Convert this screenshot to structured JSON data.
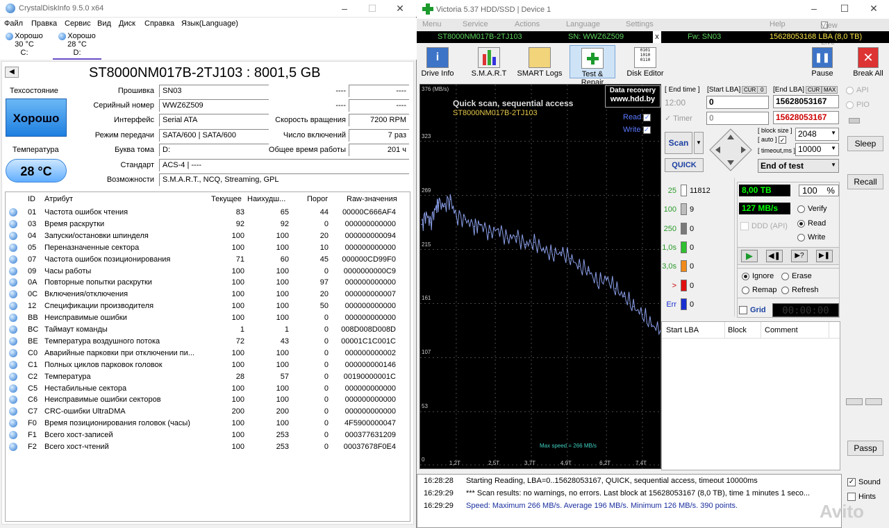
{
  "cdi": {
    "title": "CrystalDiskInfo 9.5.0 x64",
    "menu": [
      "Файл",
      "Правка",
      "Сервис",
      "Вид",
      "Диск",
      "Справка",
      "Язык(Language)"
    ],
    "disks": [
      {
        "status": "Хорошо",
        "temp": "30 °C",
        "letter": "C:"
      },
      {
        "status": "Хорошо",
        "temp": "28 °C",
        "letter": "D:"
      }
    ],
    "model": "ST8000NM017B-2TJ103 : 8001,5 GB",
    "health_label": "Техсостояние",
    "health_value": "Хорошо",
    "temp_label": "Температура",
    "temp_value": "28 °C",
    "fields": {
      "firmware": {
        "label": "Прошивка",
        "value": "SN03"
      },
      "serial": {
        "label": "Серийный номер",
        "value": "WWZ6Z509"
      },
      "interface": {
        "label": "Интерфейс",
        "value": "Serial ATA"
      },
      "transfer": {
        "label": "Режим передачи",
        "value": "SATA/600 | SATA/600"
      },
      "letter": {
        "label": "Буква тома",
        "value": "D:"
      },
      "standard": {
        "label": "Стандарт",
        "value": "ACS-4 | ----"
      },
      "features": {
        "label": "Возможности",
        "value": "S.M.A.R.T., NCQ, Streaming, GPL"
      },
      "dash1": "----",
      "dash2": "----",
      "dash3": "----",
      "dash4": "----",
      "rpm": {
        "label": "Скорость вращения",
        "value": "7200 RPM"
      },
      "power_count": {
        "label": "Число включений",
        "value": "7 раз"
      },
      "power_hours": {
        "label": "Общее время работы",
        "value": "201 ч"
      }
    },
    "smart_headers": [
      "ID",
      "Атрибут",
      "Текущее",
      "Наихудш...",
      "Порог",
      "Raw-значения"
    ],
    "smart_rows": [
      [
        "01",
        "Частота ошибок чтения",
        "83",
        "65",
        "44",
        "00000C666AF4"
      ],
      [
        "03",
        "Время раскрутки",
        "92",
        "92",
        "0",
        "000000000000"
      ],
      [
        "04",
        "Запуски/остановки шпинделя",
        "100",
        "100",
        "20",
        "000000000094"
      ],
      [
        "05",
        "Переназначенные сектора",
        "100",
        "100",
        "10",
        "000000000000"
      ],
      [
        "07",
        "Частота ошибок позиционирования",
        "71",
        "60",
        "45",
        "000000CD99F0"
      ],
      [
        "09",
        "Часы работы",
        "100",
        "100",
        "0",
        "0000000000C9"
      ],
      [
        "0A",
        "Повторные попытки раскрутки",
        "100",
        "100",
        "97",
        "000000000000"
      ],
      [
        "0C",
        "Включения/отключения",
        "100",
        "100",
        "20",
        "000000000007"
      ],
      [
        "12",
        "Спецификации производителя",
        "100",
        "100",
        "50",
        "000000000000"
      ],
      [
        "BB",
        "Неисправимые ошибки",
        "100",
        "100",
        "0",
        "000000000000"
      ],
      [
        "BC",
        "Таймаут команды",
        "1",
        "1",
        "0",
        "008D008D008D"
      ],
      [
        "BE",
        "Температура воздушного потока",
        "72",
        "43",
        "0",
        "00001C1C001C"
      ],
      [
        "C0",
        "Аварийные парковки при отключении пи...",
        "100",
        "100",
        "0",
        "000000000002"
      ],
      [
        "C1",
        "Полных циклов парковок головок",
        "100",
        "100",
        "0",
        "000000000146"
      ],
      [
        "C2",
        "Температура",
        "28",
        "57",
        "0",
        "00190000001C"
      ],
      [
        "C5",
        "Нестабильные сектора",
        "100",
        "100",
        "0",
        "000000000000"
      ],
      [
        "C6",
        "Неисправимые ошибки секторов",
        "100",
        "100",
        "0",
        "000000000000"
      ],
      [
        "C7",
        "CRC-ошибки UltraDMA",
        "200",
        "200",
        "0",
        "000000000000"
      ],
      [
        "F0",
        "Время позиционирования головок (часы)",
        "100",
        "100",
        "0",
        "4F5900000047"
      ],
      [
        "F1",
        "Всего хост-записей",
        "100",
        "253",
        "0",
        "000377631209"
      ],
      [
        "F2",
        "Всего хост-чтений",
        "100",
        "253",
        "0",
        "00037678F0E4"
      ]
    ]
  },
  "victoria": {
    "title": "Victoria 5.37 HDD/SSD | Device 1",
    "menu": [
      "Menu",
      "Service",
      "Actions",
      "Language",
      "Settings",
      "Help",
      "View Buffer Live"
    ],
    "info": {
      "model": "ST8000NM017B-2TJ103",
      "sn": "SN: WWZ6Z509",
      "x": "x",
      "fw": "Fw: SN03",
      "lba": "15628053168 LBA (8,0 TB)"
    },
    "toolbar": [
      "Drive Info",
      "S.M.A.R.T",
      "SMART Logs",
      "Test & Repair",
      "Disk Editor"
    ],
    "pause": "Pause",
    "break": "Break All",
    "graph": {
      "unit": "376 (MB/s)",
      "line1": "Quick scan, sequential access",
      "line2": "ST8000NM017B-2TJ103",
      "promo1": "Data recovery",
      "promo2": "www.hdd.by",
      "read": "Read",
      "write": "Write",
      "maxspeed": "Max speed = 266 MB/s",
      "yticks": [
        "323",
        "269",
        "215",
        "161",
        "107",
        "53",
        "0"
      ],
      "xticks": [
        "1,2T",
        "2,5T",
        "3,7T",
        "4,9T",
        "6,2T",
        "7,4T"
      ]
    },
    "chart_data": {
      "type": "line",
      "title": "Quick scan, sequential access",
      "ylabel": "MB/s",
      "ylim": [
        0,
        376
      ],
      "x": [
        0.05,
        0.2,
        0.35,
        0.5,
        0.6,
        0.8,
        1.0,
        1.2,
        1.5,
        1.8,
        2.0,
        2.3,
        2.6,
        2.9,
        3.2,
        3.5,
        3.8,
        4.1,
        4.4,
        4.7,
        5.0,
        5.3,
        5.6,
        5.9,
        6.2,
        6.5,
        6.8,
        7.1,
        7.4,
        7.7,
        8.0
      ],
      "y": [
        240,
        250,
        242,
        255,
        262,
        258,
        265,
        248,
        245,
        238,
        240,
        232,
        235,
        226,
        228,
        220,
        222,
        215,
        210,
        212,
        206,
        198,
        194,
        182,
        186,
        176,
        168,
        158,
        150,
        140,
        134
      ],
      "xunit": "TB"
    },
    "end_time_label": "End time",
    "start_lba_label": "Start LBA",
    "cur_label": "CUR",
    "end_lba_label": "End LBA",
    "max_label": "MAX",
    "zero_label": "0",
    "end_time": "12:00",
    "start_lba": "0",
    "end_lba": "15628053167",
    "timer_label": "Timer",
    "timer_value": "0",
    "lba2": "15628053167",
    "scan_label": "Scan",
    "quick_label": "QUICK",
    "blocksize_label": "block size",
    "auto_label": "auto",
    "timeout_label": "timeout,ms",
    "block_size": "2048",
    "timeout": "10000",
    "end_of_test": "End of test",
    "legend": [
      {
        "ms": "25",
        "count": "11812",
        "color": "#ffffff"
      },
      {
        "ms": "100",
        "count": "9",
        "color": "#bdbdbd"
      },
      {
        "ms": "250",
        "count": "0",
        "color": "#7a7a7a"
      },
      {
        "ms": "1,0s",
        "count": "0",
        "color": "#2fbf2f"
      },
      {
        "ms": "3,0s",
        "count": "0",
        "color": "#f08a1a"
      },
      {
        "ms": ">",
        "count": "0",
        "color": "#e01010"
      },
      {
        "ms": "Err",
        "count": "0",
        "color": "#1a2fd0"
      }
    ],
    "size_done": "8,00 TB",
    "percent": "100",
    "percent_sign": "%",
    "speed": "127 MB/s",
    "ddd": "DDD (API)",
    "verify": "Verify",
    "read": "Read",
    "write": "Write",
    "ignore": "Ignore",
    "erase": "Erase",
    "remap": "Remap",
    "refresh": "Refresh",
    "grid": "Grid",
    "clock": "00:00:00",
    "table_headers": [
      "Start LBA",
      "Block",
      "Comment"
    ],
    "api": "API",
    "pio": "PIO",
    "sleep": "Sleep",
    "recall": "Recall",
    "passp": "Passp",
    "sound": "Sound",
    "hints": "Hints",
    "log": [
      {
        "time": "16:28:28",
        "text": "Starting Reading, LBA=0..15628053167, QUICK, sequential access, timeout 10000ms",
        "color": "#000"
      },
      {
        "time": "16:29:29",
        "text": "*** Scan results: no warnings, no errors. Last block at 15628053167 (8,0 TB), time 1 minutes 1 seco...",
        "color": "#000"
      },
      {
        "time": "16:29:29",
        "text": "Speed: Maximum 266 MB/s. Average 196 MB/s. Minimum 126 MB/s. 390 points.",
        "color": "#1a2f9e"
      }
    ],
    "watermark": "Avito"
  }
}
